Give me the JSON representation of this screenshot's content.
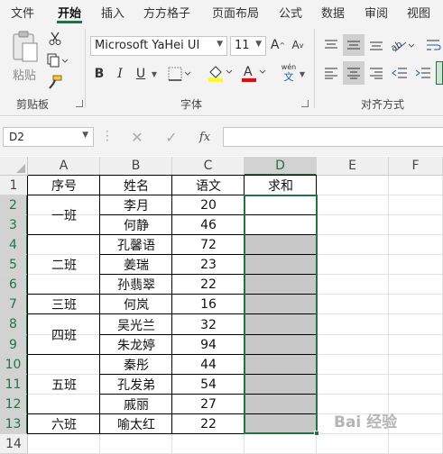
{
  "menu": {
    "tabs": [
      "文件",
      "开始",
      "插入",
      "方方格子",
      "页面布局",
      "公式",
      "数据",
      "审阅",
      "视图"
    ],
    "active": "开始"
  },
  "ribbon": {
    "clipboard": {
      "paste_label": "粘贴",
      "group_label": "剪贴板"
    },
    "font": {
      "font_name": "Microsoft YaHei UI",
      "font_size": "11",
      "bold": "B",
      "italic": "I",
      "underline": "U",
      "grow": "A",
      "shrink": "A",
      "group_label": "字体",
      "fill_color": "#ffff00",
      "font_color": "#ff0000",
      "phonetic_top": "wén",
      "phonetic_bottom": "文"
    },
    "alignment": {
      "group_label": "对齐方式"
    }
  },
  "formula_bar": {
    "name_box": "D2",
    "fx": "fx",
    "value": ""
  },
  "sheet": {
    "columns": [
      "A",
      "B",
      "C",
      "D",
      "E",
      "F"
    ],
    "selected_column": "D",
    "rows": [
      "1",
      "2",
      "3",
      "4",
      "5",
      "6",
      "7",
      "8",
      "9",
      "10",
      "11",
      "12",
      "13",
      "14"
    ],
    "selected_rows": [
      "2",
      "3",
      "4",
      "5",
      "6",
      "7",
      "8",
      "9",
      "10",
      "11",
      "12",
      "13"
    ],
    "header": {
      "a": "序号",
      "b": "姓名",
      "c": "语文",
      "d": "求和"
    },
    "groups": [
      {
        "label": "一班",
        "start": 2,
        "end": 3
      },
      {
        "label": "二班",
        "start": 4,
        "end": 6
      },
      {
        "label": "三班",
        "start": 7,
        "end": 7
      },
      {
        "label": "四班",
        "start": 8,
        "end": 9
      },
      {
        "label": "五班",
        "start": 10,
        "end": 12
      },
      {
        "label": "六班",
        "start": 13,
        "end": 13
      }
    ],
    "data": [
      {
        "name": "李月",
        "score": "20"
      },
      {
        "name": "何静",
        "score": "46"
      },
      {
        "name": "孔馨语",
        "score": "72"
      },
      {
        "name": "姜瑞",
        "score": "23"
      },
      {
        "name": "孙翡翠",
        "score": "22"
      },
      {
        "name": "何岚",
        "score": "16"
      },
      {
        "name": "吴光兰",
        "score": "32"
      },
      {
        "name": "朱龙婷",
        "score": "94"
      },
      {
        "name": "秦彤",
        "score": "44"
      },
      {
        "name": "孔发弟",
        "score": "54"
      },
      {
        "name": "戚丽",
        "score": "27"
      },
      {
        "name": "喻太红",
        "score": "22"
      }
    ]
  },
  "colors": {
    "accent": "#217346",
    "shade": "#c8c8c8"
  },
  "watermark": "Bai 经验"
}
